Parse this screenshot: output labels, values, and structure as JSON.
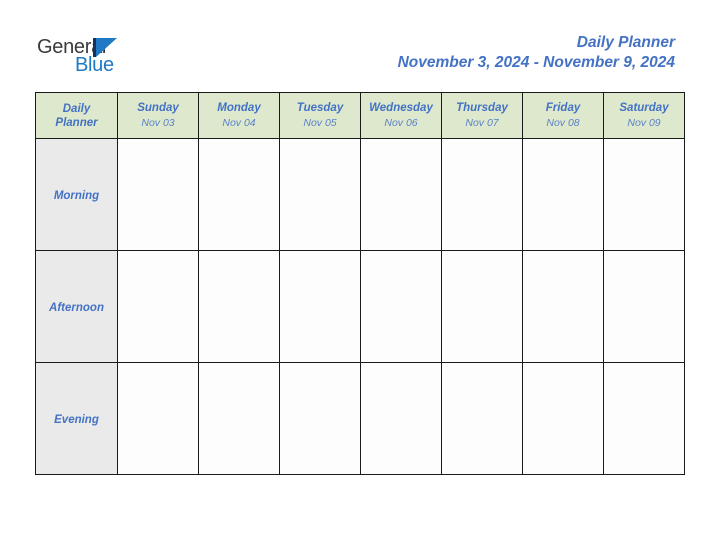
{
  "brand": {
    "name_part1": "General",
    "name_part2": "Blue",
    "mark_icon": "triangle-logo-icon",
    "colors": {
      "general_text": "#3a3a3a",
      "blue_text": "#1f79c4",
      "mark_bar": "#16315c",
      "mark_triangle": "#1f79c4"
    }
  },
  "header": {
    "title": "Daily Planner",
    "date_range": "November 3, 2024 - November 9, 2024",
    "title_color": "#4472c4"
  },
  "table": {
    "corner": {
      "line1": "Daily",
      "line2": "Planner"
    },
    "header_bg": "#dde8cd",
    "rowlabel_bg": "#eaeaea",
    "cell_bg": "#fdfdfd",
    "border_color": "#1a1a1a",
    "columns": [
      {
        "day": "Sunday",
        "date": "Nov 03"
      },
      {
        "day": "Monday",
        "date": "Nov 04"
      },
      {
        "day": "Tuesday",
        "date": "Nov 05"
      },
      {
        "day": "Wednesday",
        "date": "Nov 06"
      },
      {
        "day": "Thursday",
        "date": "Nov 07"
      },
      {
        "day": "Friday",
        "date": "Nov 08"
      },
      {
        "day": "Saturday",
        "date": "Nov 09"
      }
    ],
    "rows": [
      {
        "label": "Morning",
        "cells": [
          "",
          "",
          "",
          "",
          "",
          "",
          ""
        ]
      },
      {
        "label": "Afternoon",
        "cells": [
          "",
          "",
          "",
          "",
          "",
          "",
          ""
        ]
      },
      {
        "label": "Evening",
        "cells": [
          "",
          "",
          "",
          "",
          "",
          "",
          ""
        ]
      }
    ]
  }
}
